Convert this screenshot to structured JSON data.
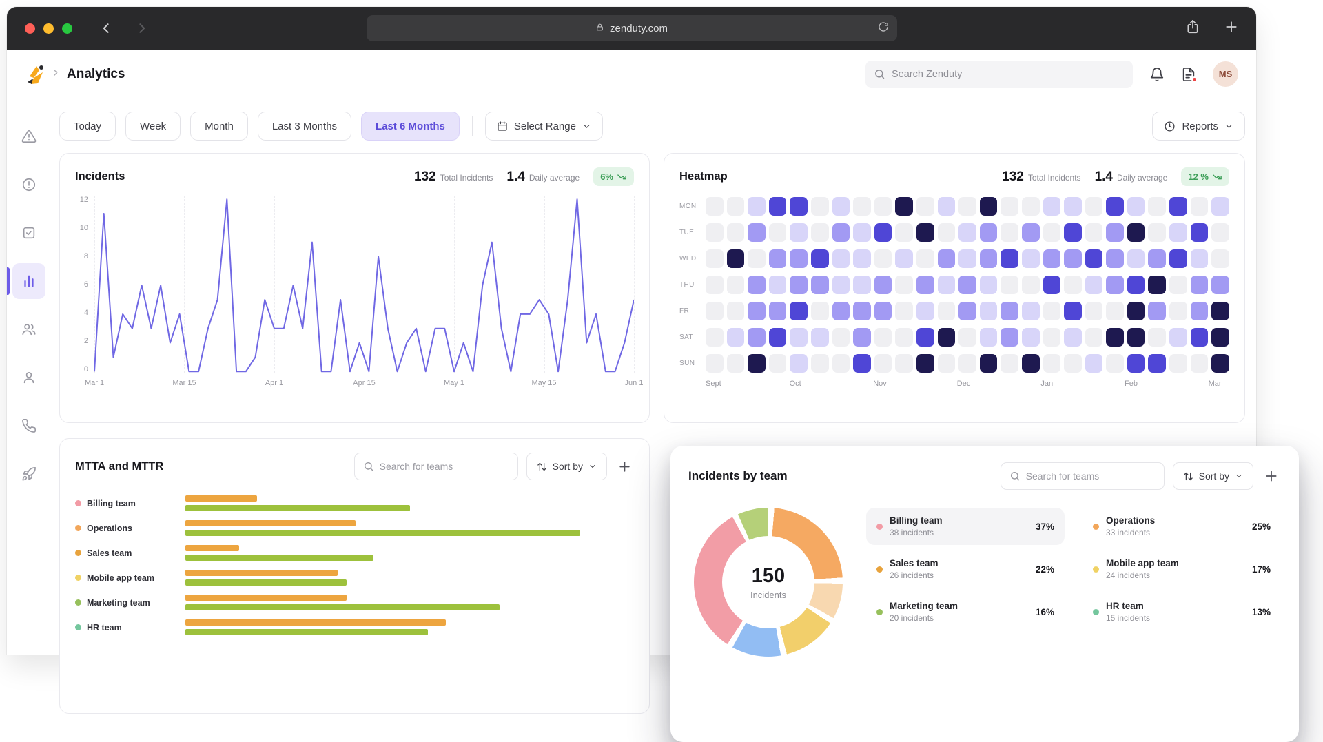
{
  "browser": {
    "url": "zenduty.com"
  },
  "app_header": {
    "title": "Analytics",
    "search_placeholder": "Search Zenduty",
    "avatar_initials": "MS"
  },
  "sidebar": {
    "icons": [
      "alert-triangle",
      "alert-circle",
      "check-square",
      "bar-chart",
      "users",
      "user",
      "phone",
      "rocket"
    ],
    "active": "bar-chart"
  },
  "filters": {
    "options": [
      "Today",
      "Week",
      "Month",
      "Last 3 Months",
      "Last 6 Months"
    ],
    "selected": "Last 6 Months",
    "select_range_label": "Select Range",
    "reports_label": "Reports"
  },
  "incidents_card": {
    "title": "Incidents",
    "total_value": "132",
    "total_label": "Total Incidents",
    "avg_value": "1.4",
    "avg_label": "Daily average",
    "badge": "6%"
  },
  "heatmap_card": {
    "title": "Heatmap",
    "total_value": "132",
    "total_label": "Total Incidents",
    "avg_value": "1.4",
    "avg_label": "Daily average",
    "badge": "12 %"
  },
  "mtta_card": {
    "title": "MTTA and MTTR",
    "search_placeholder": "Search for teams",
    "sort_label": "Sort by"
  },
  "team_card": {
    "title": "Incidents by team",
    "search_placeholder": "Search for teams",
    "sort_label": "Sort by",
    "center_value": "150",
    "center_label": "Incidents"
  },
  "colors": {
    "accent": "#6d5ce8",
    "line": "#7068e4",
    "badge_bg": "#e3f4e7",
    "badge_text": "#3c9e57",
    "mtta_bar": "#eda53f",
    "mttr_bar": "#9dc13c"
  },
  "chart_data": [
    {
      "type": "line",
      "title": "Incidents",
      "x_labels": [
        "Mar 1",
        "Mar 15",
        "Apr 1",
        "Apr 15",
        "May 1",
        "May 15",
        "Jun 1"
      ],
      "yticks": [
        12,
        10,
        8,
        6,
        4,
        2,
        0
      ],
      "ylim": [
        0,
        12
      ],
      "values": [
        0,
        11,
        1,
        4,
        3,
        6,
        3,
        6,
        2,
        4,
        0,
        0,
        3,
        5,
        12,
        0,
        0,
        1,
        5,
        3,
        3,
        6,
        3,
        9,
        0,
        0,
        5,
        0,
        2,
        0,
        8,
        3,
        0,
        2,
        3,
        0,
        3,
        3,
        0,
        2,
        0,
        6,
        9,
        3,
        0,
        4,
        4,
        5,
        4,
        0,
        5,
        12,
        2,
        4,
        0,
        0,
        2,
        5
      ]
    },
    {
      "type": "heatmap",
      "title": "Heatmap",
      "rows": [
        "MON",
        "TUE",
        "WED",
        "THU",
        "FRI",
        "SAT",
        "SUN"
      ],
      "months": [
        {
          "label": "Sept",
          "col": 0
        },
        {
          "label": "Oct",
          "col": 4
        },
        {
          "label": "Nov",
          "col": 8
        },
        {
          "label": "Dec",
          "col": 12
        },
        {
          "label": "Jan",
          "col": 16
        },
        {
          "label": "Feb",
          "col": 20
        },
        {
          "label": "Mar",
          "col": 24
        }
      ],
      "palette": [
        "#efeff2",
        "#d8d5f9",
        "#a29af3",
        "#4f46d6",
        "#1e1950"
      ],
      "levels": [
        [
          0,
          0,
          1,
          3,
          3,
          0,
          1,
          0,
          0,
          4,
          0,
          1,
          0,
          4,
          0,
          0,
          1,
          1,
          0,
          3,
          1,
          0,
          3,
          0,
          1
        ],
        [
          0,
          0,
          2,
          0,
          1,
          0,
          2,
          1,
          3,
          0,
          4,
          0,
          1,
          2,
          0,
          2,
          0,
          3,
          0,
          2,
          4,
          0,
          1,
          3,
          0
        ],
        [
          0,
          4,
          0,
          2,
          2,
          3,
          1,
          1,
          0,
          1,
          0,
          2,
          1,
          2,
          3,
          1,
          2,
          2,
          3,
          2,
          1,
          2,
          3,
          1,
          0
        ],
        [
          0,
          0,
          2,
          1,
          2,
          2,
          1,
          1,
          2,
          0,
          2,
          1,
          2,
          1,
          0,
          0,
          3,
          0,
          1,
          2,
          3,
          4,
          0,
          2,
          2
        ],
        [
          0,
          0,
          2,
          2,
          3,
          0,
          2,
          2,
          2,
          0,
          1,
          0,
          2,
          1,
          2,
          1,
          0,
          3,
          0,
          0,
          4,
          2,
          0,
          2,
          4
        ],
        [
          0,
          1,
          2,
          3,
          1,
          1,
          0,
          2,
          0,
          0,
          3,
          4,
          0,
          1,
          2,
          1,
          0,
          1,
          0,
          4,
          4,
          0,
          1,
          3,
          4
        ],
        [
          0,
          0,
          4,
          0,
          1,
          0,
          0,
          3,
          0,
          0,
          4,
          0,
          0,
          4,
          0,
          4,
          0,
          0,
          1,
          0,
          3,
          3,
          0,
          0,
          4
        ]
      ]
    },
    {
      "type": "bar",
      "title": "MTTA and MTTR",
      "max": 50,
      "teams": [
        {
          "name": "Billing team",
          "dot": "#f29ba5",
          "mtta": 8,
          "mttr": 25
        },
        {
          "name": "Operations",
          "dot": "#f2a65a",
          "mtta": 19,
          "mttr": 44
        },
        {
          "name": "Sales team",
          "dot": "#e8a33d",
          "mtta": 6,
          "mttr": 21
        },
        {
          "name": "Mobile app team",
          "dot": "#f0d264",
          "mtta": 17,
          "mttr": 18
        },
        {
          "name": "Marketing team",
          "dot": "#97c05c",
          "mtta": 18,
          "mttr": 35
        },
        {
          "name": "HR team",
          "dot": "#74c69d",
          "mtta": 29,
          "mttr": 27
        }
      ]
    },
    {
      "type": "pie",
      "title": "Incidents by team",
      "center_value": "150",
      "center_label": "Incidents",
      "segments": [
        {
          "color": "#f5a962",
          "pct": 24
        },
        {
          "color": "#f8d8b0",
          "pct": 9
        },
        {
          "color": "#f2cf6b",
          "pct": 13
        },
        {
          "color": "#92bdf3",
          "pct": 12
        },
        {
          "color": "#f29da6",
          "pct": 34
        },
        {
          "color": "#b5d079",
          "pct": 8
        }
      ],
      "legend": [
        {
          "name": "Billing team",
          "sub": "38 incidents",
          "pct": "37%",
          "color": "#f29ba5",
          "highlight": true
        },
        {
          "name": "Sales team",
          "sub": "26 incidents",
          "pct": "22%",
          "color": "#e8a33d",
          "highlight": false
        },
        {
          "name": "Marketing team",
          "sub": "20 incidents",
          "pct": "16%",
          "color": "#97c05c",
          "highlight": false
        },
        {
          "name": "Operations",
          "sub": "33 incidents",
          "pct": "25%",
          "color": "#f2a65a",
          "highlight": false
        },
        {
          "name": "Mobile app team",
          "sub": "24 incidents",
          "pct": "17%",
          "color": "#f0d264",
          "highlight": false
        },
        {
          "name": "HR team",
          "sub": "15 incidents",
          "pct": "13%",
          "color": "#74c69d",
          "highlight": false
        }
      ]
    }
  ]
}
